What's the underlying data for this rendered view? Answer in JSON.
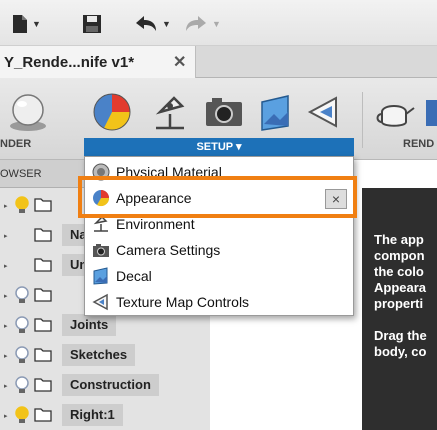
{
  "window": {
    "document_tab": "Y_Rende...nife v1*",
    "tab_close": "✕"
  },
  "toolbar": {
    "file_menu": "file-icon",
    "save": "save-icon",
    "undo": "undo-icon",
    "redo": "redo-icon"
  },
  "ribbon": {
    "workspace_label": "NDER",
    "setup_label": "SETUP ▾",
    "right_label": "REND",
    "icons": [
      "render-sphere-icon",
      "appearance-icon",
      "environment-lamp-icon",
      "camera-icon",
      "decal-icon",
      "texture-map-icon",
      "teapot-icon"
    ]
  },
  "browser": {
    "header": "OWSER",
    "rows": [
      {
        "label": "",
        "bulb_color": "#f2c319"
      },
      {
        "label": "Na",
        "bulb_color": ""
      },
      {
        "label": "Un",
        "bulb_color": ""
      },
      {
        "label": "",
        "bulb_color": "#8c9bb5"
      },
      {
        "label": "Joints",
        "bulb_color": "#8c9bb5"
      },
      {
        "label": "Sketches",
        "bulb_color": "#8c9bb5"
      },
      {
        "label": "Construction",
        "bulb_color": "#8c9bb5"
      },
      {
        "label": "Right:1",
        "bulb_color": "#f2c319"
      }
    ]
  },
  "menu": {
    "items": [
      {
        "label": "Physical Material",
        "icon": "physical-material-icon"
      },
      {
        "label": "Appearance",
        "icon": "appearance-icon",
        "close": "×"
      },
      {
        "label": "Environment",
        "icon": "environment-icon"
      },
      {
        "label": "Camera Settings",
        "icon": "camera-settings-icon"
      },
      {
        "label": "Decal",
        "icon": "decal-icon"
      },
      {
        "label": "Texture Map Controls",
        "icon": "texture-map-icon"
      }
    ]
  },
  "tooltip": {
    "lines": [
      "The app",
      "compon",
      "the colo",
      "Appeara",
      "properti",
      "Drag the",
      "body, co"
    ]
  },
  "colors": {
    "accent_blue": "#1d71b8",
    "highlight_orange": "#f07f12",
    "tooltip_bg": "#2e2e2e"
  }
}
